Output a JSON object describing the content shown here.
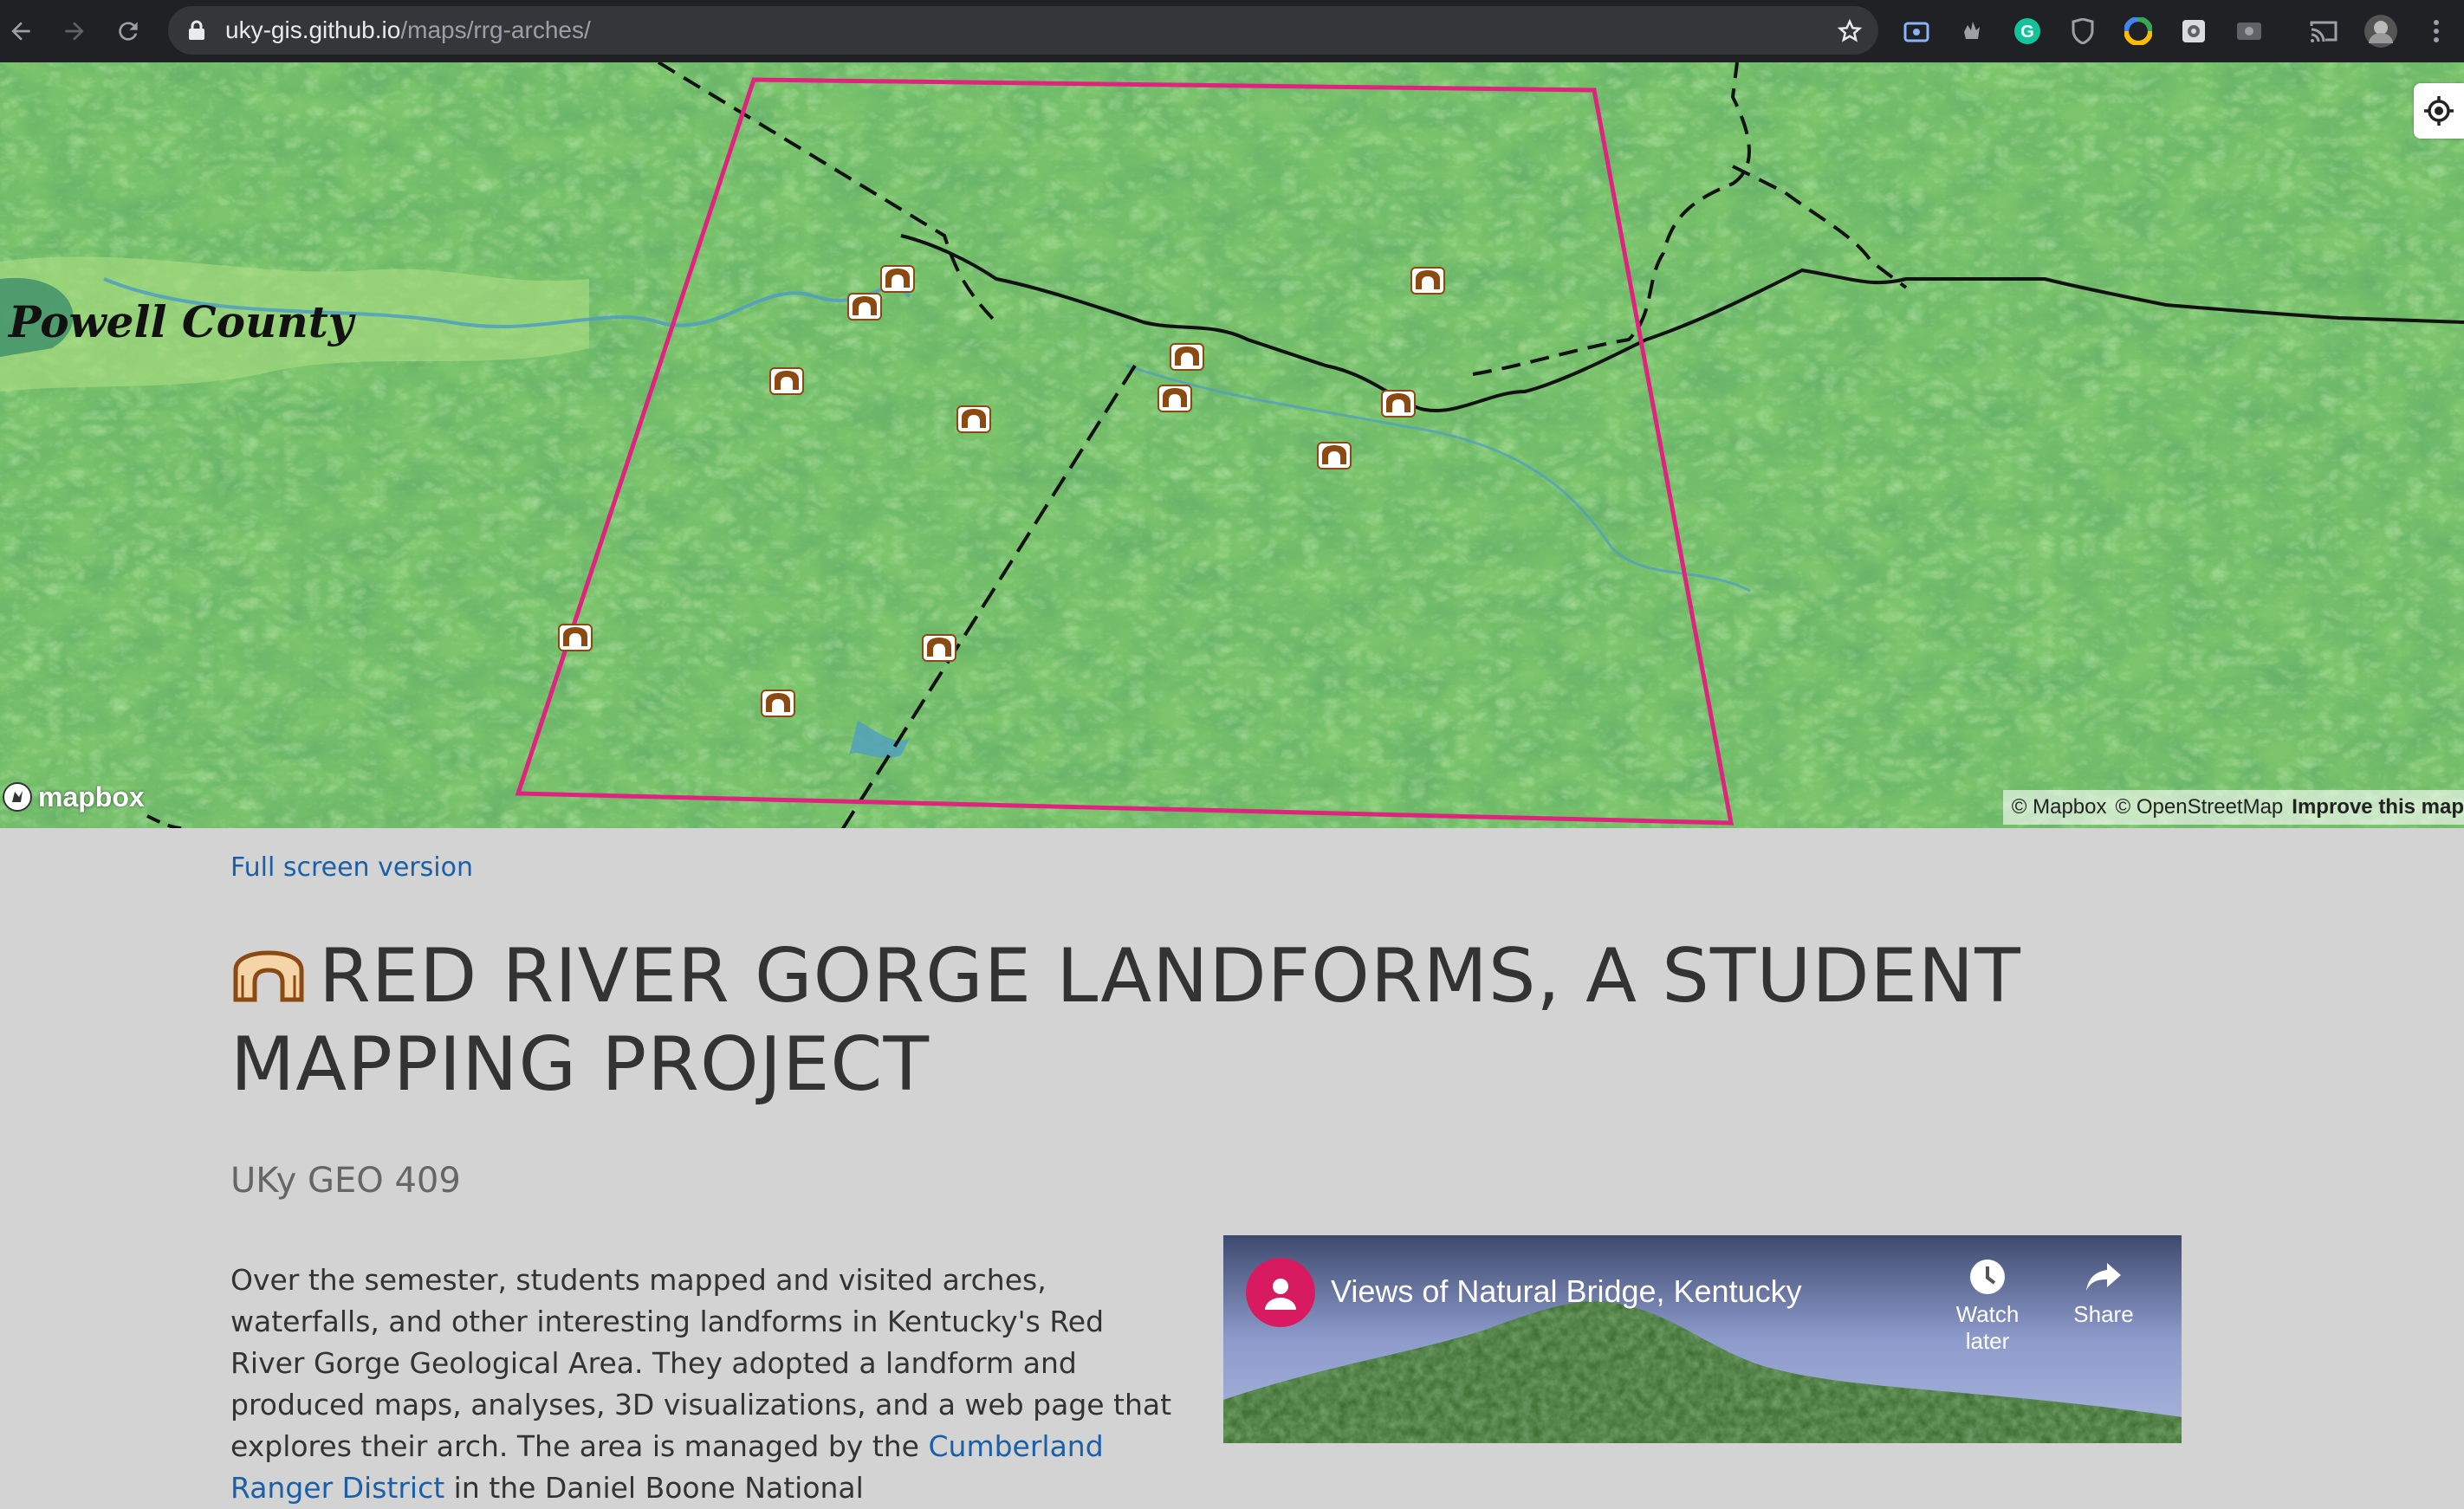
{
  "browser": {
    "url_host": "uky-gis.github.io",
    "url_path": "/maps/rrg-arches/"
  },
  "map": {
    "county_label": "Powell County",
    "mapbox_logo_text": "mapbox",
    "attribution": {
      "mapbox": "© Mapbox",
      "osm": "© OpenStreetMap",
      "improve": "Improve this map"
    },
    "colors": {
      "terrain": "#79c46a",
      "study_area_outline": "#e0237f",
      "arch_icon": "#8b4a12"
    }
  },
  "page": {
    "fullscreen_link": "Full screen version",
    "title": "RED RIVER GORGE LANDFORMS, A STUDENT MAPPING PROJECT",
    "subtitle": "UKy GEO 409",
    "body_part1": "Over the semester, students mapped and visited arches, waterfalls, and other interesting landforms in Kentucky's Red River Gorge Geological Area. They adopted a landform and produced maps, analyses, 3D visualizations, and a web page that explores their arch. The area is ",
    "body_part2": "managed by the ",
    "body_link": "Cumberland Ranger District",
    "body_part3": " in the Daniel Boone National"
  },
  "video": {
    "title": "Views of Natural Bridge, Kentucky",
    "watch_later": "Watch later",
    "share": "Share"
  }
}
